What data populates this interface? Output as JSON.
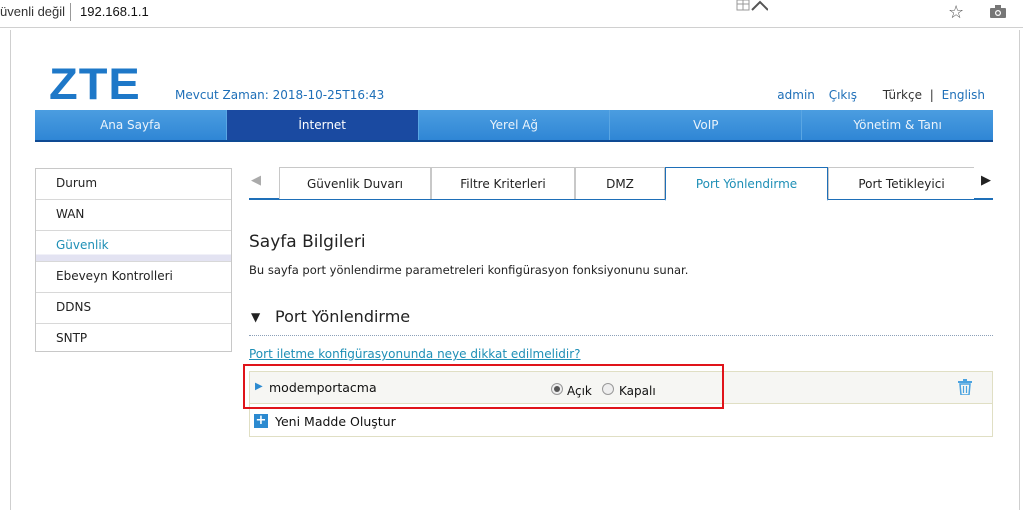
{
  "browser": {
    "security_text": "üvenli değil",
    "url": "192.168.1.1"
  },
  "header": {
    "logo": "ZTE",
    "current_time": "Mevcut Zaman: 2018-10-25T16:43",
    "admin_link": "admin",
    "logout_link": "Çıkış",
    "lang_tr": "Türkçe",
    "lang_sep": "|",
    "lang_en": "English"
  },
  "main_nav": {
    "items": [
      {
        "label": "Ana Sayfa"
      },
      {
        "label": "İnternet"
      },
      {
        "label": "Yerel Ağ"
      },
      {
        "label": "VoIP"
      },
      {
        "label": "Yönetim & Tanı"
      }
    ],
    "active_index": 1
  },
  "sidebar": {
    "items": [
      {
        "label": "Durum"
      },
      {
        "label": "WAN"
      },
      {
        "label": "Güvenlik"
      },
      {
        "label": "Ebeveyn Kontrolleri"
      },
      {
        "label": "DDNS"
      },
      {
        "label": "SNTP"
      }
    ],
    "active_index": 2
  },
  "tabs": {
    "items": [
      {
        "label": "Güvenlik Duvarı"
      },
      {
        "label": "Filtre Kriterleri"
      },
      {
        "label": "DMZ"
      },
      {
        "label": "Port Yönlendirme"
      },
      {
        "label": "Port Tetikleyici"
      }
    ],
    "active_index": 3
  },
  "content": {
    "page_title": "Sayfa Bilgileri",
    "page_description": "Bu sayfa port yönlendirme parametreleri konfigürasyon fonksiyonunu sunar.",
    "section_title": "Port Yönlendirme",
    "help_link": "Port iletme konfigürasyonunda neye dikkat edilmelidir?",
    "rules": [
      {
        "name": "modemportacma",
        "option_on": "Açık",
        "option_off": "Kapalı",
        "selected": "Açık"
      }
    ],
    "add_new": "Yeni Madde Oluştur"
  },
  "colors": {
    "brand_blue": "#1e78c8",
    "nav_active": "#1a4aa1",
    "highlight_red": "#e0141a"
  }
}
